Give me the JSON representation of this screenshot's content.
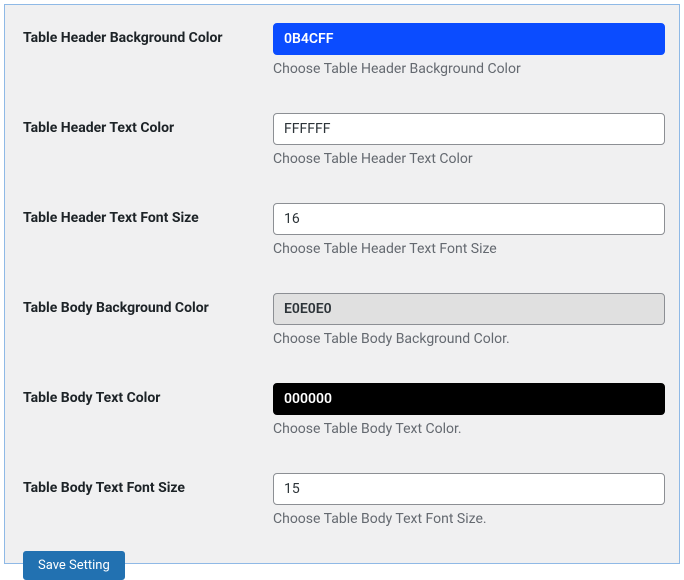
{
  "fields": {
    "header_bg": {
      "label": "Table Header Background Color",
      "value": "0B4CFF",
      "help": "Choose Table Header Background Color"
    },
    "header_text_color": {
      "label": "Table Header Text Color",
      "value": "FFFFFF",
      "help": "Choose Table Header Text Color"
    },
    "header_font_size": {
      "label": "Table Header Text Font Size",
      "value": "16",
      "help": "Choose Table Header Text Font Size"
    },
    "body_bg": {
      "label": "Table Body Background Color",
      "value": "E0E0E0",
      "help": "Choose Table Body Background Color."
    },
    "body_text_color": {
      "label": "Table Body Text Color",
      "value": "000000",
      "help": "Choose Table Body Text Color."
    },
    "body_font_size": {
      "label": "Table Body Text Font Size",
      "value": "15",
      "help": "Choose Table Body Text Font Size."
    }
  },
  "buttons": {
    "save": "Save Setting"
  }
}
